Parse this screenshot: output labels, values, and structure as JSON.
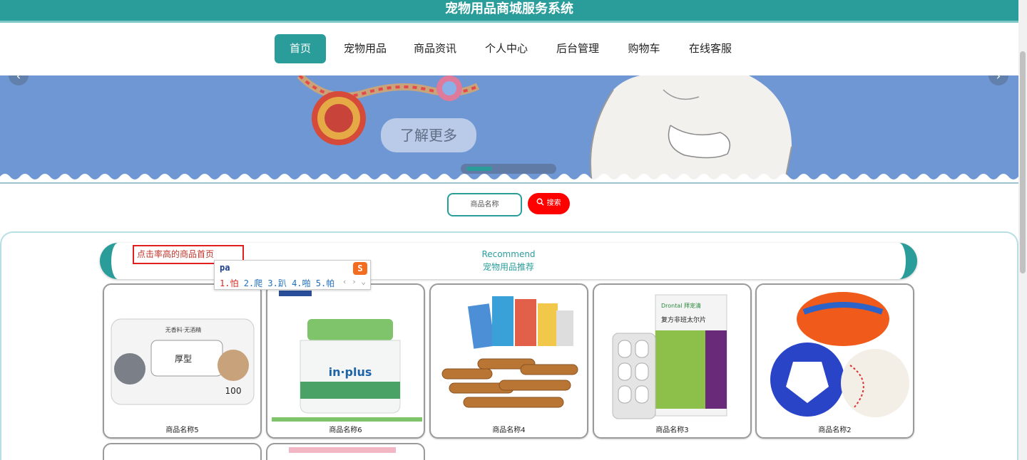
{
  "header": {
    "title": "宠物用品商城服务系统"
  },
  "nav": {
    "items": [
      {
        "label": "首页",
        "active": true
      },
      {
        "label": "宠物用品",
        "active": false
      },
      {
        "label": "商品资讯",
        "active": false
      },
      {
        "label": "个人中心",
        "active": false
      },
      {
        "label": "后台管理",
        "active": false
      },
      {
        "label": "购物车",
        "active": false
      },
      {
        "label": "在线客服",
        "active": false
      }
    ]
  },
  "banner": {
    "button_label": "了解更多",
    "prev_icon": "chevron-left-icon",
    "next_icon": "chevron-right-icon"
  },
  "search": {
    "placeholder": "商品名称",
    "button_label": "搜索",
    "button_color": "#ff0000"
  },
  "recommend": {
    "title_en": "Recommend",
    "title_cn": "宠物用品推荐",
    "click_hint": "点击率高的商品首页"
  },
  "ime": {
    "input": "pa",
    "candidates": [
      "1.怕",
      "2.爬",
      "3.趴",
      "4.啪",
      "5.帕"
    ]
  },
  "products": [
    {
      "name": "商品名称5"
    },
    {
      "name": "商品名称6"
    },
    {
      "name": "商品名称4"
    },
    {
      "name": "商品名称3"
    },
    {
      "name": "商品名称2"
    }
  ],
  "colors": {
    "accent": "#2a9d9b",
    "banner": "#6e97d3",
    "search_button": "#ff0000"
  }
}
